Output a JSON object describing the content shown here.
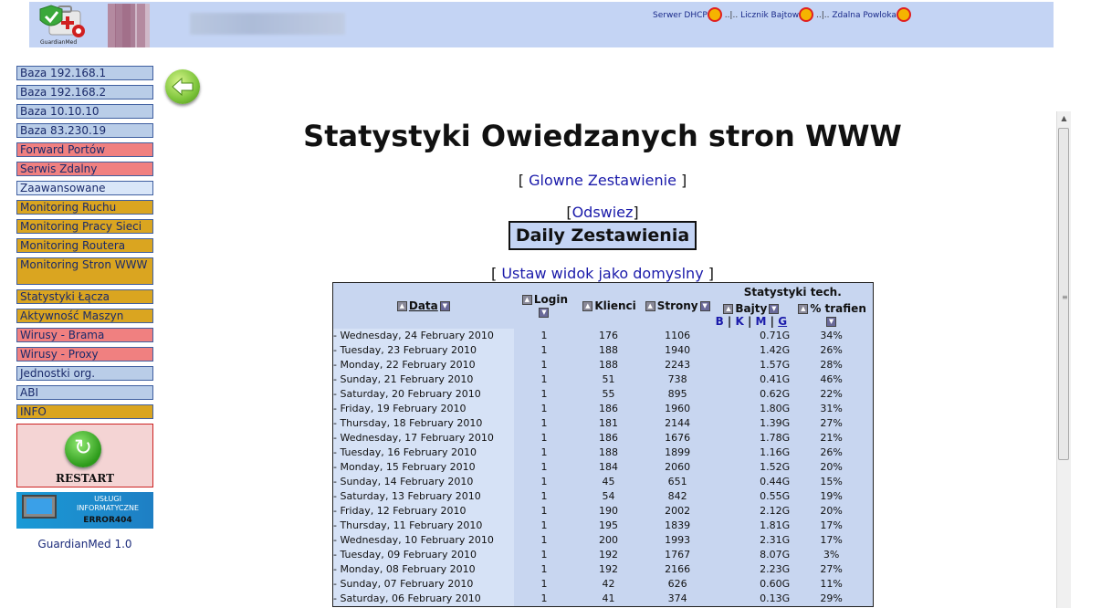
{
  "header": {
    "logo_caption": "GuardianMed",
    "links": [
      "Serwer DHCP",
      "Licznik Bajtow",
      "Zdalna Powloka"
    ],
    "separator": "..|.."
  },
  "sidebar": {
    "items": [
      {
        "label": "Baza 192.168.1",
        "style": "blue"
      },
      {
        "label": "Baza 192.168.2",
        "style": "blue"
      },
      {
        "label": "Baza 10.10.10",
        "style": "blue"
      },
      {
        "label": "Baza 83.230.19",
        "style": "blue"
      },
      {
        "label": "Forward Portów",
        "style": "red"
      },
      {
        "label": "Serwis Zdalny",
        "style": "red"
      },
      {
        "label": "Zaawansowane",
        "style": "light"
      },
      {
        "label": "Monitoring Ruchu",
        "style": "gold"
      },
      {
        "label": "Monitoring Pracy Sieci",
        "style": "gold"
      },
      {
        "label": "Monitoring Routera",
        "style": "gold"
      },
      {
        "label": "Monitoring Stron WWW",
        "style": "gold"
      },
      {
        "label": "Statystyki Łącza",
        "style": "gold"
      },
      {
        "label": "Aktywność Maszyn",
        "style": "gold"
      },
      {
        "label": "Wirusy - Brama",
        "style": "red"
      },
      {
        "label": "Wirusy - Proxy",
        "style": "red"
      },
      {
        "label": "Jednostki org.",
        "style": "blue"
      },
      {
        "label": "ABI",
        "style": "blue"
      },
      {
        "label": "INFO",
        "style": "gold"
      }
    ],
    "restart_label": "RESTART",
    "banner": {
      "line1": "USŁUGI",
      "line2": "INFORMATYCZNE",
      "line3": "ERROR404"
    },
    "version": "GuardianMed 1.0"
  },
  "main": {
    "title": "Statystyki Owiedzanych stron WWW",
    "link_glowne": "Glowne Zestawienie",
    "link_odswiez": "Odswiez",
    "section_title": "Daily Zestawienia",
    "link_domyslny": "Ustaw widok jako domyslny",
    "bracket_open": "[",
    "bracket_close": "]"
  },
  "table": {
    "headers": {
      "data": "Data",
      "login": "Login",
      "klienci": "Klienci",
      "strony": "Strony",
      "stat_tech": "Statystyki tech.",
      "bajty": "Bajty",
      "units": [
        "B",
        "K",
        "M",
        "G"
      ],
      "trafien": "% trafien"
    },
    "rows": [
      {
        "date": "- Wednesday, 24 February 2010",
        "login": "1",
        "klienci": "176",
        "strony": "1106",
        "bajty": "0.71G",
        "traf": "34%"
      },
      {
        "date": "- Tuesday, 23 February 2010",
        "login": "1",
        "klienci": "188",
        "strony": "1940",
        "bajty": "1.42G",
        "traf": "26%"
      },
      {
        "date": "- Monday, 22 February 2010",
        "login": "1",
        "klienci": "188",
        "strony": "2243",
        "bajty": "1.57G",
        "traf": "28%"
      },
      {
        "date": "- Sunday, 21 February 2010",
        "login": "1",
        "klienci": "51",
        "strony": "738",
        "bajty": "0.41G",
        "traf": "46%"
      },
      {
        "date": "- Saturday, 20 February 2010",
        "login": "1",
        "klienci": "55",
        "strony": "895",
        "bajty": "0.62G",
        "traf": "22%"
      },
      {
        "date": "- Friday, 19 February 2010",
        "login": "1",
        "klienci": "186",
        "strony": "1960",
        "bajty": "1.80G",
        "traf": "31%"
      },
      {
        "date": "- Thursday, 18 February 2010",
        "login": "1",
        "klienci": "181",
        "strony": "2144",
        "bajty": "1.39G",
        "traf": "27%"
      },
      {
        "date": "- Wednesday, 17 February 2010",
        "login": "1",
        "klienci": "186",
        "strony": "1676",
        "bajty": "1.78G",
        "traf": "21%"
      },
      {
        "date": "- Tuesday, 16 February 2010",
        "login": "1",
        "klienci": "188",
        "strony": "1899",
        "bajty": "1.16G",
        "traf": "26%"
      },
      {
        "date": "- Monday, 15 February 2010",
        "login": "1",
        "klienci": "184",
        "strony": "2060",
        "bajty": "1.52G",
        "traf": "20%"
      },
      {
        "date": "- Sunday, 14 February 2010",
        "login": "1",
        "klienci": "45",
        "strony": "651",
        "bajty": "0.44G",
        "traf": "15%"
      },
      {
        "date": "- Saturday, 13 February 2010",
        "login": "1",
        "klienci": "54",
        "strony": "842",
        "bajty": "0.55G",
        "traf": "19%"
      },
      {
        "date": "- Friday, 12 February 2010",
        "login": "1",
        "klienci": "190",
        "strony": "2002",
        "bajty": "2.12G",
        "traf": "20%"
      },
      {
        "date": "- Thursday, 11 February 2010",
        "login": "1",
        "klienci": "195",
        "strony": "1839",
        "bajty": "1.81G",
        "traf": "17%"
      },
      {
        "date": "- Wednesday, 10 February 2010",
        "login": "1",
        "klienci": "200",
        "strony": "1993",
        "bajty": "2.31G",
        "traf": "17%"
      },
      {
        "date": "- Tuesday, 09 February 2010",
        "login": "1",
        "klienci": "192",
        "strony": "1767",
        "bajty": "8.07G",
        "traf": "3%"
      },
      {
        "date": "- Monday, 08 February 2010",
        "login": "1",
        "klienci": "192",
        "strony": "2166",
        "bajty": "2.23G",
        "traf": "27%"
      },
      {
        "date": "- Sunday, 07 February 2010",
        "login": "1",
        "klienci": "42",
        "strony": "626",
        "bajty": "0.60G",
        "traf": "11%"
      },
      {
        "date": "- Saturday, 06 February 2010",
        "login": "1",
        "klienci": "41",
        "strony": "374",
        "bajty": "0.13G",
        "traf": "29%"
      }
    ]
  },
  "colors": {
    "header_bg": "#c4d4f4",
    "nav_blue": "#b9cde8",
    "nav_red": "#f08080",
    "nav_gold": "#daa520",
    "table_bg": "#c8d6f0",
    "link": "#1a1aaa"
  }
}
